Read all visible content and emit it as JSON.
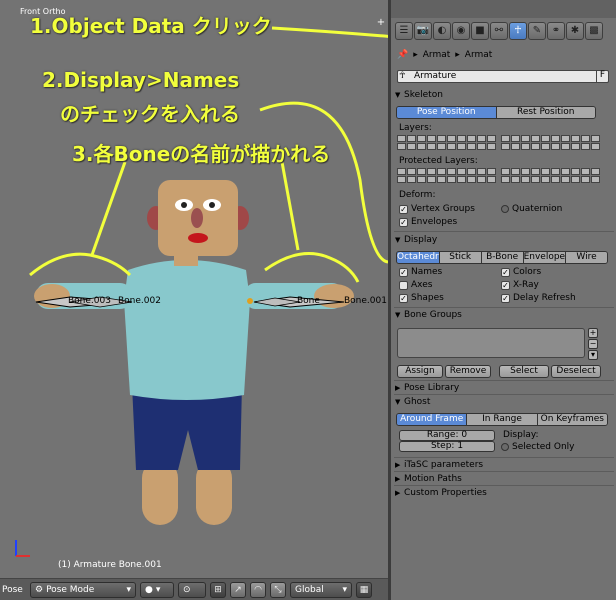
{
  "viewport": {
    "title": "Front Ortho",
    "status": "(1) Armature Bone.001",
    "bones": [
      "Bone.003",
      "Bone.002",
      "Bone",
      "Bone.001"
    ]
  },
  "annotations": {
    "step1": "1.Object Data クリック",
    "step2_line1": "2.Display>Names",
    "step2_line2": "のチェックを入れる",
    "step3": "3.各Boneの名前が描かれる",
    "color": "#f2ff3c"
  },
  "bottombar": {
    "editor": "Pose",
    "mode": "Pose Mode",
    "orientation": "Global"
  },
  "props": {
    "breadcrumb_a": "Armat",
    "breadcrumb_b": "Armat",
    "name": "Armature",
    "name_tag": "F",
    "skeleton": {
      "header": "Skeleton",
      "pose_position": "Pose Position",
      "rest_position": "Rest Position",
      "layers_label": "Layers:",
      "protected_label": "Protected Layers:",
      "deform_label": "Deform:",
      "vertex_groups": "Vertex Groups",
      "envelopes": "Envelopes",
      "quaternion": "Quaternion"
    },
    "display": {
      "header": "Display",
      "modes": [
        "Octahedr",
        "Stick",
        "B-Bone",
        "Envelope",
        "Wire"
      ],
      "names": "Names",
      "axes": "Axes",
      "shapes": "Shapes",
      "colors": "Colors",
      "xray": "X-Ray",
      "delay_refresh": "Delay Refresh"
    },
    "bone_groups": {
      "header": "Bone Groups",
      "assign": "Assign",
      "remove": "Remove",
      "select": "Select",
      "deselect": "Deselect"
    },
    "pose_library": "Pose Library",
    "ghost": {
      "header": "Ghost",
      "around_frame": "Around Frame",
      "in_range": "In Range",
      "on_keyframes": "On Keyframes",
      "range": "Range: 0",
      "step": "Step: 1",
      "display_label": "Display:",
      "selected_only": "Selected Only"
    },
    "itasc": "iTaSC parameters",
    "motion_paths": "Motion Paths",
    "custom_properties": "Custom Properties"
  }
}
